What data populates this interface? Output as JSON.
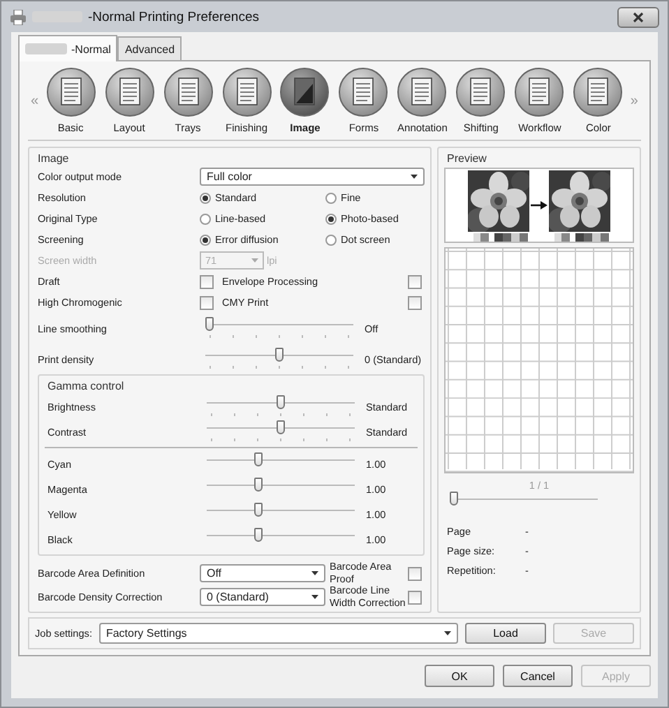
{
  "window": {
    "title": "-Normal Printing Preferences"
  },
  "tabs": [
    {
      "label": "-Normal",
      "selected": true
    },
    {
      "label": "Advanced",
      "selected": false
    }
  ],
  "toolbar": {
    "scroll_left": "«",
    "scroll_right": "»",
    "items": [
      {
        "label": "Basic",
        "selected": false
      },
      {
        "label": "Layout",
        "selected": false
      },
      {
        "label": "Trays",
        "selected": false
      },
      {
        "label": "Finishing",
        "selected": false
      },
      {
        "label": "Image",
        "selected": true
      },
      {
        "label": "Forms",
        "selected": false
      },
      {
        "label": "Annotation",
        "selected": false
      },
      {
        "label": "Shifting",
        "selected": false
      },
      {
        "label": "Workflow",
        "selected": false
      },
      {
        "label": "Color",
        "selected": false
      }
    ]
  },
  "image_settings": {
    "title": "Image",
    "rows": [
      {
        "kind": "dropdown",
        "label": "Color output mode",
        "value": "Full color"
      },
      {
        "kind": "radio",
        "label": "Resolution",
        "options": [
          {
            "label": "Standard",
            "selected": true
          },
          {
            "label": "Fine",
            "selected": false
          }
        ]
      },
      {
        "kind": "radio",
        "label": "Original Type",
        "options": [
          {
            "label": "Line-based",
            "selected": false
          },
          {
            "label": "Photo-based",
            "selected": true
          }
        ]
      },
      {
        "kind": "radio",
        "label": "Screening",
        "options": [
          {
            "label": "Error diffusion",
            "selected": true
          },
          {
            "label": "Dot screen",
            "selected": false
          }
        ]
      },
      {
        "kind": "spinner",
        "label": "Screen width",
        "value": "71",
        "unit": "lpi",
        "disabled": true
      },
      {
        "kind": "checks",
        "label": "Draft",
        "checked": false,
        "option": {
          "label": "Envelope Processing",
          "checked": false
        }
      },
      {
        "kind": "checks",
        "label": "High Chromogenic",
        "checked": false,
        "option": {
          "label": "CMY Print",
          "checked": false
        }
      },
      {
        "kind": "slider",
        "label": "Line smoothing",
        "level": 0,
        "reading": "Off",
        "ticks": true
      },
      {
        "kind": "slider",
        "label": "Print density",
        "level": 0.5,
        "reading": "0 (Standard)",
        "ticks": true
      }
    ],
    "gamma_control": {
      "title": "Gamma control",
      "groups": [
        [
          {
            "label": "Brightness",
            "level": 0.5,
            "reading": "Standard",
            "ticks": true
          },
          {
            "label": "Contrast",
            "level": 0.5,
            "reading": "Standard",
            "ticks": true
          }
        ],
        [
          {
            "label": "Cyan",
            "level": 0.34,
            "reading": "1.00",
            "ticks": false
          },
          {
            "label": "Magenta",
            "level": 0.34,
            "reading": "1.00",
            "ticks": false
          },
          {
            "label": "Yellow",
            "level": 0.34,
            "reading": "1.00",
            "ticks": false
          },
          {
            "label": "Black",
            "level": 0.34,
            "reading": "1.00",
            "ticks": false
          }
        ]
      ]
    },
    "barcode_rows": [
      {
        "label": "Barcode Area Definition",
        "value": "Off",
        "option": {
          "label": "Barcode Area Proof",
          "checked": false
        }
      },
      {
        "label": "Barcode Density Correction",
        "value": "0 (Standard)",
        "option": {
          "label": "Barcode Line Width Correction",
          "checked": false
        }
      }
    ]
  },
  "preview": {
    "title": "Preview",
    "page_counter": "1 / 1",
    "slider": {
      "level": 0
    },
    "info": [
      {
        "label": "Page",
        "value": "-"
      },
      {
        "label": "Page size:",
        "value": "-"
      },
      {
        "label": "Repetition:",
        "value": "-"
      }
    ]
  },
  "job_settings": {
    "label": "Job settings:",
    "value": "Factory Settings",
    "buttons": [
      {
        "label": "Load",
        "disabled": false
      },
      {
        "label": "Save",
        "disabled": true
      }
    ]
  },
  "buttons": [
    {
      "label": "OK",
      "disabled": false
    },
    {
      "label": "Cancel",
      "disabled": false
    },
    {
      "label": "Apply",
      "disabled": true
    }
  ]
}
